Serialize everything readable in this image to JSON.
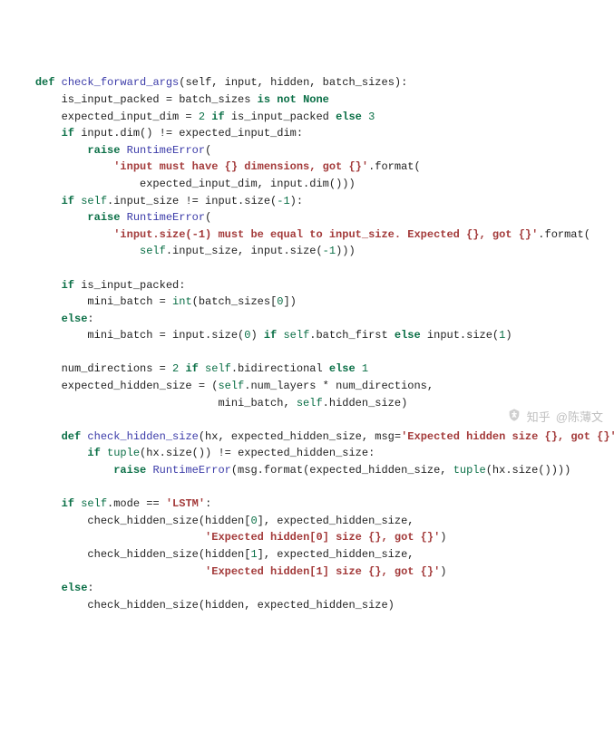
{
  "code": {
    "def": "def",
    "raise": "raise",
    "if": "if",
    "else": "else",
    "is_not": "is not",
    "none": "None",
    "self": "self",
    "int": "int",
    "tuple": "tuple",
    "runtime_error": "RuntimeError",
    "fn_check_forward_args": "check_forward_args",
    "fn_check_hidden_size": "check_hidden_size",
    "params1": "(self, input, hidden, batch_sizes):",
    "line_is_input_packed": "is_input_packed = batch_sizes ",
    "line_expected_dim_pre": "expected_input_dim = ",
    "n2": "2",
    "n3": "3",
    "n1": "1",
    "n0": "0",
    "nn1": "-1",
    "if_packed_mid": " is_input_packed ",
    "if_dim_pre": " input.dim() != expected_input_dim:",
    "format_paren": ".format(",
    "str_input_dims": "'input must have {} dimensions, got {}'",
    "fmt_args1": "expected_input_dim, input.dim()))",
    "if_size_pre": ".input_size != input.size(",
    "close_colon": "):",
    "str_input_size": "'input.size(-1) must be equal to input_size. Expected {}, got {}'",
    "fmt_args2_pre": ".input_size, input.size(",
    "fmt_args2_post": ")))",
    "if_is_input_packed": " is_input_packed:",
    "mini_batch_eq": "mini_batch = ",
    "batch_sizes_idx": "(batch_sizes[",
    "close_sq_paren": "])",
    "input_size0": "mini_batch = input.size(",
    "close_paren": ") ",
    "batch_first": ".batch_first ",
    "input_size1": " input.size(",
    "num_dirs_pre": "num_directions = ",
    "bidir": ".bidirectional ",
    "exp_hid_pre": "expected_hidden_size = (",
    "num_layers": ".num_layers * num_directions,",
    "mini_hidden": "mini_batch, ",
    "hidden_size": ".hidden_size)",
    "def2_params_pre": "(hx, expected_hidden_size, msg=",
    "str_exp_hidden": "'Expected hidden size {}, got {}'",
    "def2_params_post": "):",
    "if_tuple_pre": " ",
    "hx_size": "(hx.size()) != expected_hidden_size:",
    "raise_msg": "(msg.format(expected_hidden_size, ",
    "hx_size2": "(hx.size())))",
    "if_mode": ".mode == ",
    "str_lstm": "'LSTM'",
    "colon": ":",
    "chs_call_pre": "check_hidden_size(hidden[",
    "chs_call_mid": "], expected_hidden_size,",
    "str_exp0": "'Expected hidden[0] size {}, got {}'",
    "str_exp1": "'Expected hidden[1] size {}, got {}'",
    "close_fn": ")",
    "chs_call_else": "check_hidden_size(hidden, expected_hidden_size)"
  },
  "watermark": {
    "brand": "知乎",
    "author": "@陈薄文"
  }
}
